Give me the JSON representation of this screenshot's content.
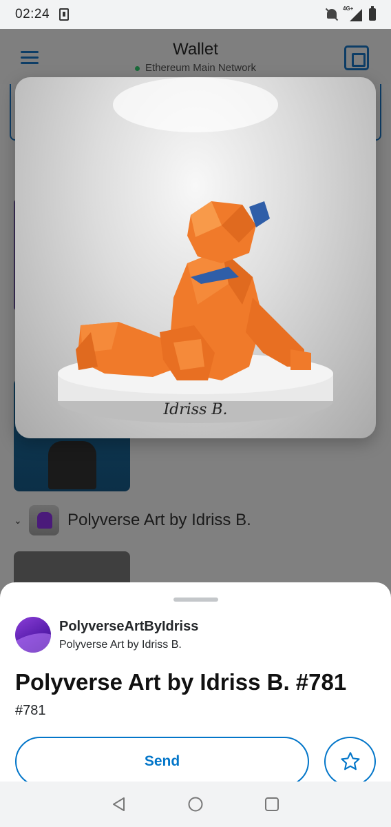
{
  "status_bar": {
    "time": "02:24",
    "network_label": "4G+"
  },
  "header": {
    "title": "Wallet",
    "network": "Ethereum Main Network"
  },
  "background_list": {
    "collection_name": "Polyverse Art by Idriss B."
  },
  "nft_preview": {
    "signature": "Idriss B."
  },
  "sheet": {
    "collection_contract_name": "PolyverseArtByIdriss",
    "collection_name": "Polyverse Art by Idriss B.",
    "nft_title": "Polyverse Art by Idriss B. #781",
    "token_id": "#781",
    "send_label": "Send"
  },
  "colors": {
    "accent": "#0376c9",
    "nft_orange": "#f07a2a",
    "nft_blue": "#2f5ea8"
  },
  "icons": {
    "menu": "hamburger-icon",
    "scan": "scan-icon",
    "favorite": "star-icon",
    "nav_back": "back-triangle-icon",
    "nav_home": "home-circle-icon",
    "nav_recents": "recents-square-icon"
  }
}
